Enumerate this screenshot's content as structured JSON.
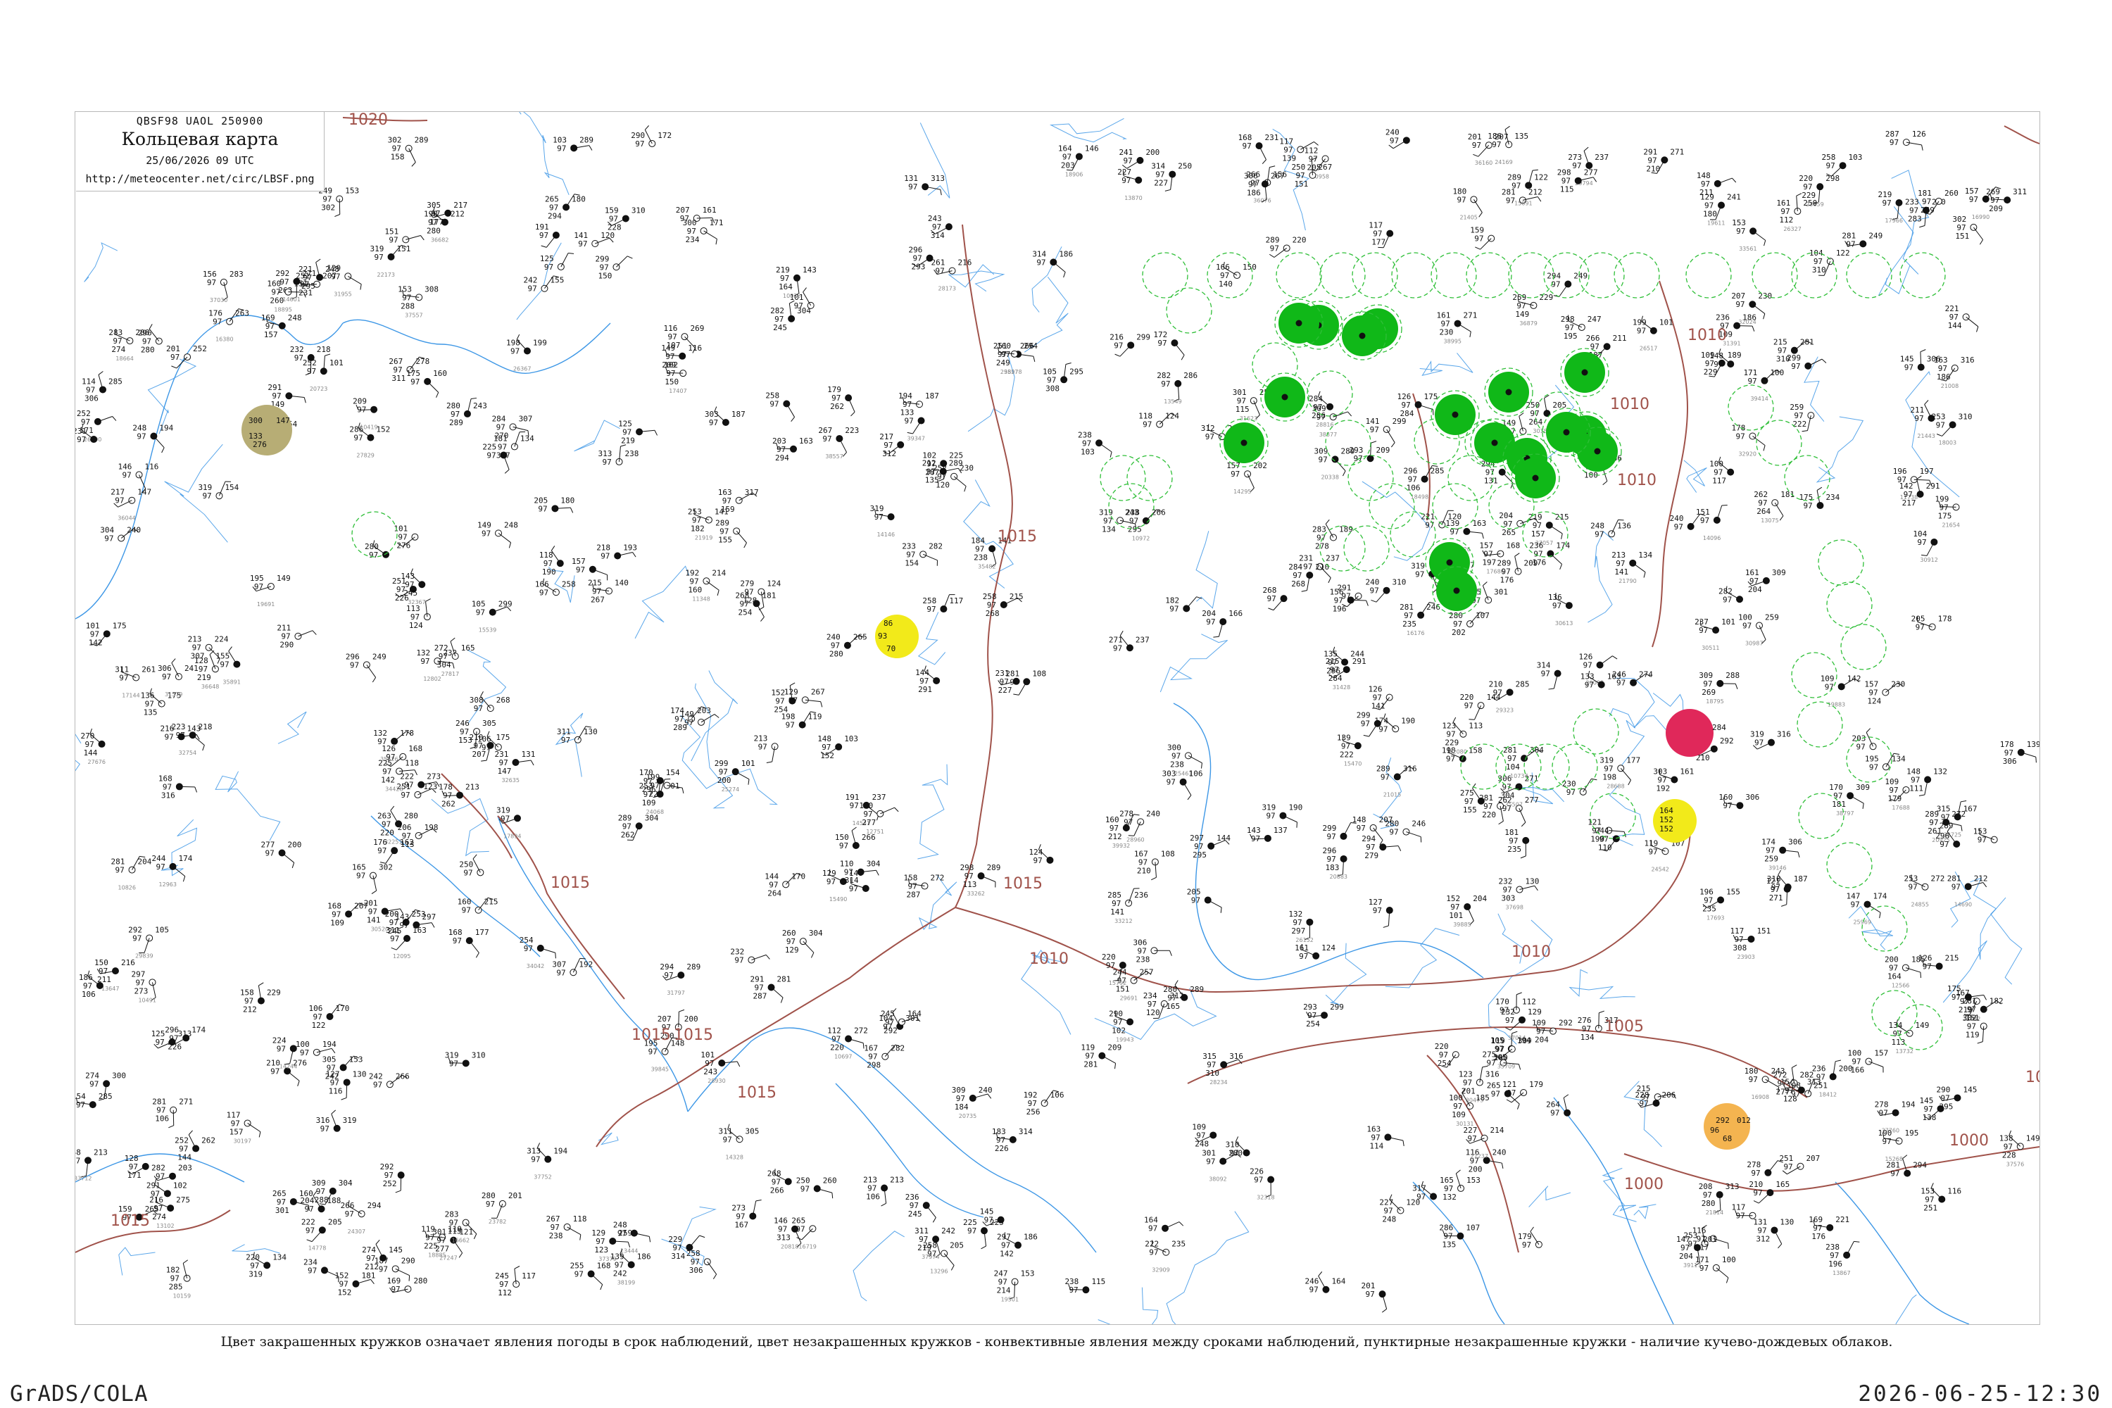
{
  "map": {
    "title_box": {
      "code": "QBSF98  UAOL  250900",
      "title": "Кольцевая карта",
      "date": "25/06/2026 09 UTC",
      "url": "http://meteocenter.net/circ/LBSF.png"
    },
    "legend_note": "Цвет закрашенных кружков означает явления погоды в срок наблюдений, цвет незакрашенных кружков - конвективные явления между сроками наблюдений, пунктирные незакрашенные кружки - наличие кучево-дождевых облаков.",
    "isobars": [
      {
        "label": "1020",
        "color": "#a0524a"
      },
      {
        "label": "1015",
        "color": "#a0524a"
      },
      {
        "label": "1010",
        "color": "#a0524a"
      },
      {
        "label": "1005",
        "color": "#a0524a"
      },
      {
        "label": "1000",
        "color": "#a0524a"
      }
    ],
    "colors": {
      "coast": "#3d97e6",
      "isobar": "#a0524a",
      "thunder_green": "#10b818",
      "convective_dashed": "#2fbf38",
      "yellow": "#f2ea1a",
      "red": "#e0285a",
      "orange": "#f4b450",
      "olive": "#b7ad75"
    },
    "markers": [
      {
        "kind": "olive",
        "values": [
          "300",
          "147",
          "133",
          "276"
        ]
      },
      {
        "kind": "yellow",
        "values": [
          "86",
          "93",
          "70"
        ]
      },
      {
        "kind": "yellow",
        "values": [
          "164",
          "152",
          "152"
        ]
      },
      {
        "kind": "red",
        "values": [
          "284"
        ]
      },
      {
        "kind": "orange",
        "values": [
          "292",
          "96",
          "68",
          "012"
        ]
      }
    ]
  },
  "footer": {
    "left": "GrADS/COLA",
    "right": "2026-06-25-12:30"
  }
}
